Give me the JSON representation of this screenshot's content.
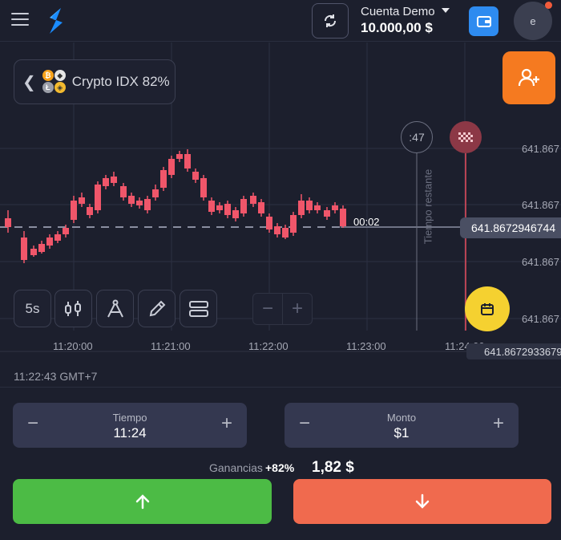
{
  "header": {
    "account_label": "Cuenta Demo",
    "balance": "10.000,00 $",
    "avatar_initial": "e"
  },
  "asset": {
    "name": "Crypto IDX 82%"
  },
  "chart": {
    "timeframe": "5s",
    "current_price": "641.8672946744",
    "secondary_price": "641.8672933679",
    "countdown": "00:02",
    "expiry_timer": ":47",
    "remaining_label": "Tiempo restante",
    "y_labels": [
      "641.867",
      "641.867",
      "641.867",
      "641.867"
    ],
    "x_labels": [
      "11:20:00",
      "11:21:00",
      "11:22:00",
      "11:23:00",
      "11:24:00"
    ],
    "colors": {
      "up": "#2bc24b",
      "down": "#f0566a",
      "grid": "#2d3142"
    }
  },
  "footer": {
    "clock": "11:22:43 GMT+7",
    "time_field": {
      "label": "Tiempo",
      "value": "11:24"
    },
    "amount_field": {
      "label": "Monto",
      "value": "$1"
    },
    "payout_label": "Ganancias",
    "payout_percent": "+82%",
    "payout_amount": "1,82 $",
    "up_color": "#4cbb45",
    "down_color": "#f06a4e"
  }
}
